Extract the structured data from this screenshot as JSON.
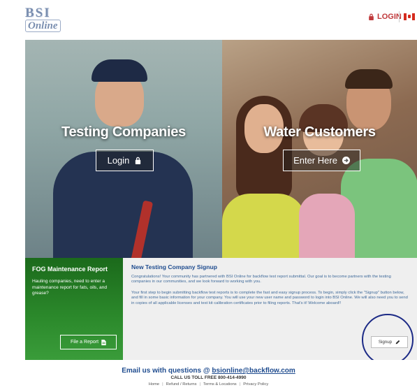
{
  "header": {
    "logo_top": "BSI",
    "logo_bottom": "Online",
    "login_label": "LOGIN",
    "brand_color": "#c0393b"
  },
  "hero": {
    "left": {
      "title": "Testing Companies",
      "button_label": "Login",
      "button_icon": "lock-icon"
    },
    "right": {
      "title": "Water Customers",
      "button_label": "Enter Here",
      "button_icon": "arrow-circle-right-icon"
    }
  },
  "fog": {
    "title": "FOG Maintenance Report",
    "text": "Hauling companies, need to enter a maintenance report for fats, oils, and grease?",
    "button_label": "File a Report",
    "button_icon": "document-icon",
    "color": "#2c8a2c"
  },
  "signup": {
    "title": "New Testing Company Signup",
    "paragraph1": "Congratulations! Your community has partnered with BSI Online for backflow test report submittal. Our goal is to become partners with the testing companies in our communities, and we look forward to working with you.",
    "paragraph2": "Your first step to begin submitting backflow test reports is to complete the fast and easy signup process. To begin, simply click the \"Signup\" button below, and fill in some basic information for your company. You will use your new user name and password to login into BSI Online. We will also need you to send in copies of all applicable licenses and test kit calibration certificates prior to filing reports. That's it! Welcome aboard!!",
    "button_label": "Signup",
    "button_icon": "pencil-icon",
    "title_color": "#1f4c8f"
  },
  "footer": {
    "email_prefix": "Email us with questions @",
    "email": "bsionline@backflow.com",
    "call": "CALL US TOLL FREE 800-414-4990",
    "links": [
      "Home",
      "Refund / Returns",
      "Terms & Locations",
      "Privacy Policy"
    ]
  }
}
